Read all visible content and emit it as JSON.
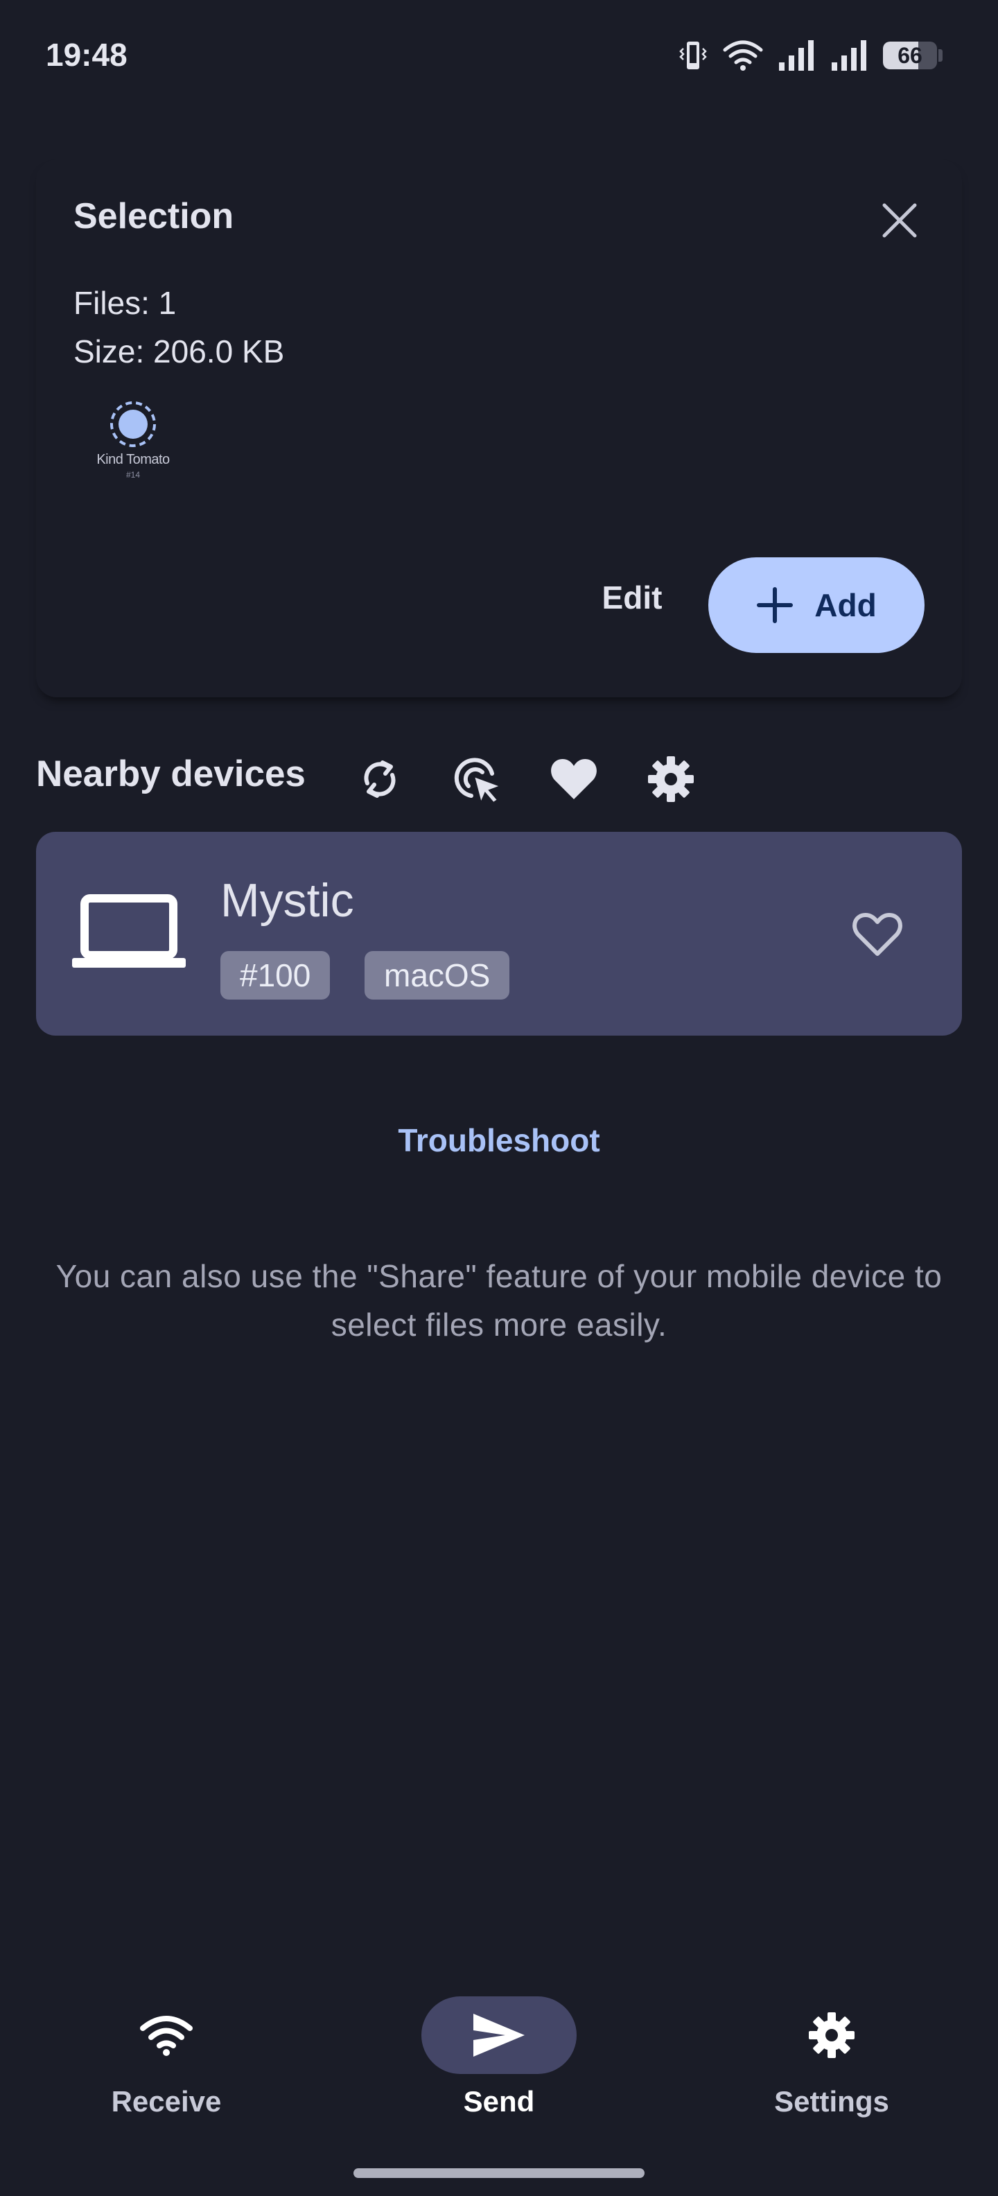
{
  "status_bar": {
    "time": "19:48",
    "battery_level": "66",
    "battery_fraction": 0.66
  },
  "selection": {
    "title": "Selection",
    "files_line": "Files: 1",
    "size_line": "Size: 206.0 KB",
    "thumbnail_label": "Kind Tomato",
    "thumbnail_sublabel": "#14",
    "edit_label": "Edit",
    "add_label": "Add"
  },
  "nearby": {
    "title": "Nearby devices",
    "icons": [
      "refresh-icon",
      "scan-target-icon",
      "favorites-icon",
      "settings-icon"
    ]
  },
  "device": {
    "name": "Mystic",
    "tags": [
      "#100",
      "macOS"
    ],
    "icon": "laptop-icon"
  },
  "troubleshoot_label": "Troubleshoot",
  "hint": "You can also use the \"Share\" feature of your mobile device to select files more easily.",
  "bottom_nav": {
    "items": [
      {
        "label": "Receive",
        "icon": "wifi-icon"
      },
      {
        "label": "Send",
        "icon": "send-icon",
        "active": true
      },
      {
        "label": "Settings",
        "icon": "settings-icon"
      }
    ]
  },
  "colors": {
    "background": "#1a1c27",
    "accent": "#b6ccff",
    "device_card": "#444667",
    "link": "#a9c2f7"
  }
}
